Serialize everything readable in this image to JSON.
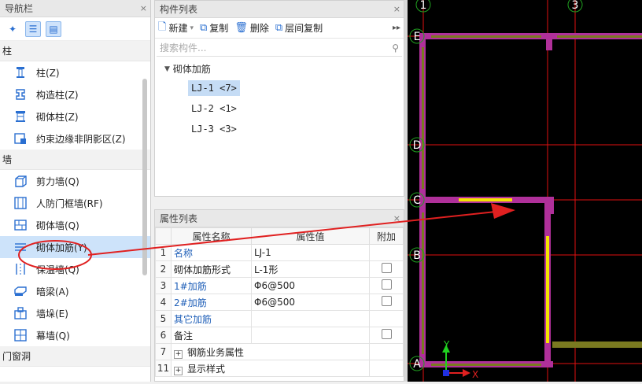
{
  "nav": {
    "title": "导航栏",
    "groups": {
      "column": "柱",
      "wall": "墙",
      "door_window": "门窗洞"
    },
    "column_items": [
      "柱(Z)",
      "构造柱(Z)",
      "砌体柱(Z)",
      "约束边缘非阴影区(Z)"
    ],
    "wall_items": [
      "剪力墙(Q)",
      "人防门框墙(RF)",
      "砌体墙(Q)",
      "砌体加筋(Y)",
      "保温墙(Q)",
      "暗梁(A)",
      "墙垛(E)",
      "幕墙(Q)"
    ],
    "selected": "砌体加筋(Y)"
  },
  "component_list": {
    "title": "构件列表",
    "toolbar": {
      "new": "新建",
      "copy": "复制",
      "delete": "删除",
      "floor_copy": "层间复制"
    },
    "search_placeholder": "搜索构件...",
    "root": "砌体加筋",
    "items": [
      "LJ-1 <7>",
      "LJ-2 <1>",
      "LJ-3 <3>"
    ]
  },
  "properties": {
    "title": "属性列表",
    "headers": {
      "name": "属性名称",
      "value": "属性值",
      "extra": "附加"
    },
    "rows": [
      {
        "num": "1",
        "name": "名称",
        "value": "LJ-1"
      },
      {
        "num": "2",
        "name": "砌体加筋形式",
        "value": "L-1形"
      },
      {
        "num": "3",
        "name": "1#加筋",
        "value": "Φ6@500"
      },
      {
        "num": "4",
        "name": "2#加筋",
        "value": "Φ6@500"
      },
      {
        "num": "5",
        "name": "其它加筋",
        "value": ""
      },
      {
        "num": "6",
        "name": "备注",
        "value": ""
      },
      {
        "num": "7",
        "name": "钢筋业务属性",
        "value": ""
      },
      {
        "num": "11",
        "name": "显示样式",
        "value": ""
      }
    ]
  },
  "canvas": {
    "axis_top": [
      "1",
      "3"
    ],
    "axis_left": [
      "E",
      "D",
      "C",
      "B",
      "A"
    ],
    "ucs_y": "Y",
    "ucs_x": "X"
  },
  "colors": {
    "wall": "#b0309a",
    "beam": "#7a7a20",
    "grid": "#e01010",
    "rebar": "#f5e400",
    "select_bg": "#cde3fa"
  }
}
